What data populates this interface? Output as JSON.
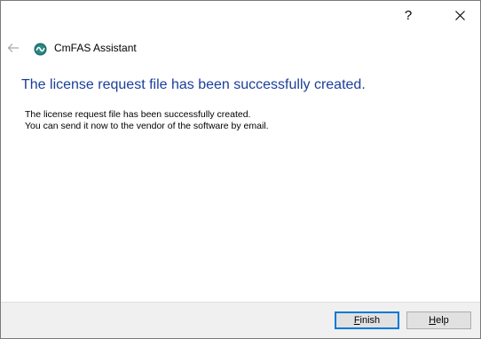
{
  "titlebar": {
    "help_glyph": "?",
    "close_icon": "close-icon"
  },
  "nav": {
    "back_icon": "back-arrow-icon",
    "app_icon": "cmfas-logo-icon",
    "title": "CmFAS Assistant"
  },
  "main": {
    "heading": "The license request file has been successfully created.",
    "lines": [
      "The license request file has been successfully created.",
      "You can send it now to the vendor of the software by email."
    ]
  },
  "footer": {
    "finish": {
      "accel": "F",
      "rest": "inish"
    },
    "help": {
      "accel": "H",
      "rest": "elp"
    }
  },
  "colors": {
    "heading": "#1b3f99",
    "accent": "#0078d7",
    "footer_bg": "#f0f0f0",
    "app_icon": "#1e6e6e"
  }
}
